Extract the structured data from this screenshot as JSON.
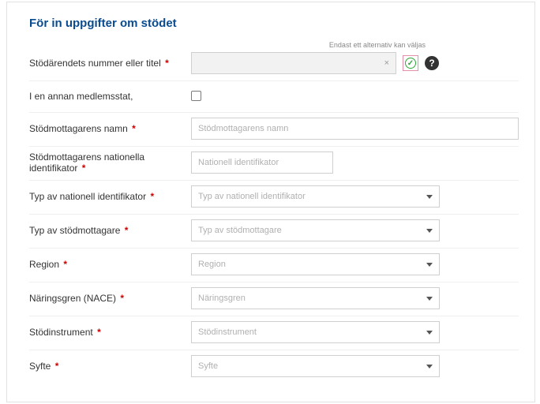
{
  "title": "För in uppgifter om stödet",
  "rows": {
    "caseNumber": {
      "label": "Stödärendets nummer eller titel",
      "required": true,
      "hint": "Endast ett alternativ kan väljas",
      "value": "",
      "clear": "×"
    },
    "otherState": {
      "label": "I en annan medlemsstat,",
      "required": false,
      "checked": false
    },
    "beneficiaryName": {
      "label": "Stödmottagarens namn",
      "required": true,
      "placeholder": "Stödmottagarens namn",
      "value": ""
    },
    "nationalId": {
      "label": "Stödmottagarens nationella identifikator",
      "required": true,
      "placeholder": "Nationell identifikator",
      "value": ""
    },
    "nationalIdType": {
      "label": "Typ av nationell identifikator",
      "required": true,
      "placeholder": "Typ av nationell identifikator"
    },
    "beneficiaryType": {
      "label": "Typ av stödmottagare",
      "required": true,
      "placeholder": "Typ av stödmottagare"
    },
    "region": {
      "label": "Region",
      "required": true,
      "placeholder": "Region"
    },
    "nace": {
      "label": "Näringsgren (NACE)",
      "required": true,
      "placeholder": "Näringsgren"
    },
    "instrument": {
      "label": "Stödinstrument",
      "required": true,
      "placeholder": "Stödinstrument"
    },
    "purpose": {
      "label": "Syfte",
      "required": true,
      "placeholder": "Syfte"
    }
  }
}
